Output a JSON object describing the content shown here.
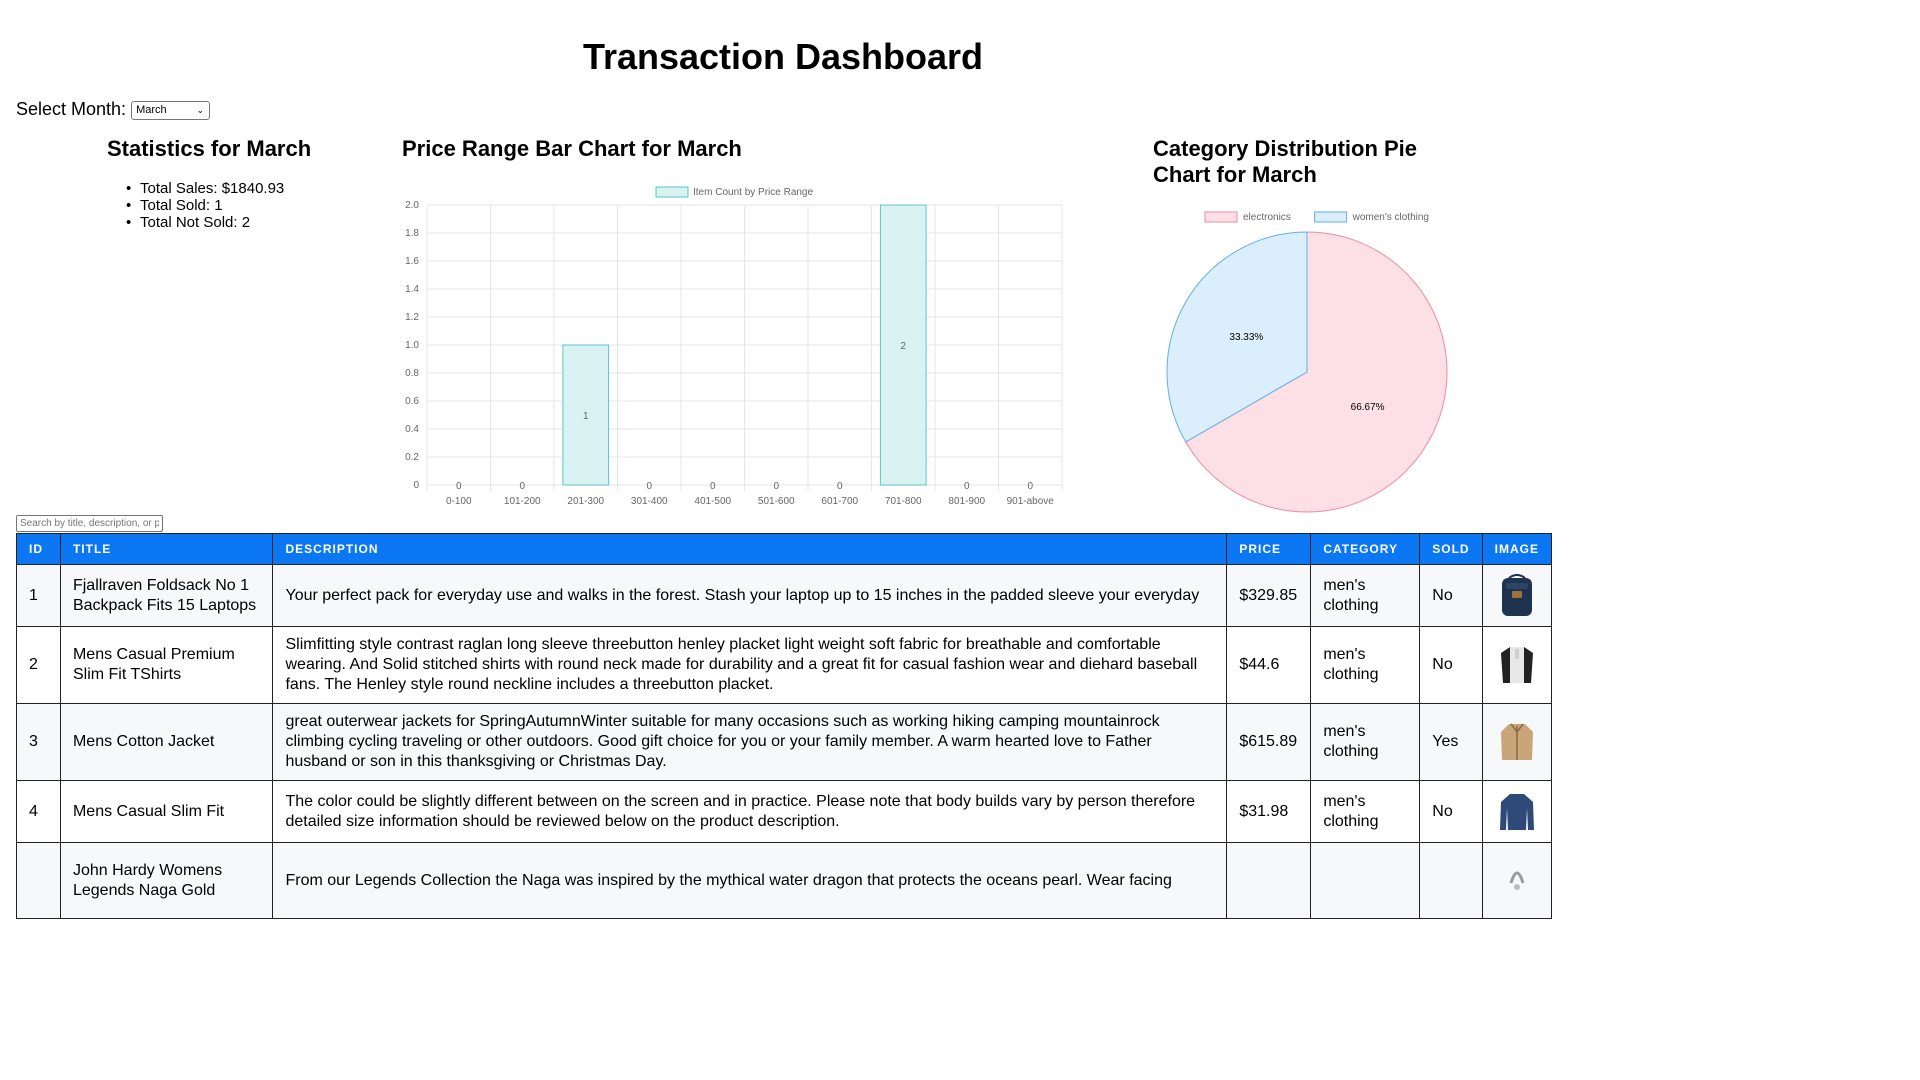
{
  "header": {
    "title": "Transaction Dashboard"
  },
  "month_selector": {
    "label": "Select Month:",
    "selected": "March"
  },
  "statistics": {
    "title": "Statistics for March",
    "items": [
      {
        "label": "Total Sales: $1840.93"
      },
      {
        "label": "Total Sold: 1"
      },
      {
        "label": "Total Not Sold: 2"
      }
    ]
  },
  "bar_section": {
    "title": "Price Range Bar Chart for March"
  },
  "pie_section": {
    "title_line1": "Category Distribution Pie",
    "title_line2": "Chart for March"
  },
  "chart_data": [
    {
      "type": "bar",
      "categories": [
        "0-100",
        "101-200",
        "201-300",
        "301-400",
        "401-500",
        "501-600",
        "601-700",
        "701-800",
        "801-900",
        "901-above"
      ],
      "series": [
        {
          "name": "Item Count by Price Range",
          "values": [
            0,
            0,
            1,
            0,
            0,
            0,
            0,
            2,
            0,
            0
          ]
        }
      ],
      "ylim": [
        0,
        2
      ],
      "yticks": [
        "0",
        "0.2",
        "0.4",
        "0.6",
        "0.8",
        "1.0",
        "1.2",
        "1.4",
        "1.6",
        "1.8",
        "2.0"
      ],
      "grid": true,
      "legend": "top",
      "colors": {
        "fill": "#d9f2f2",
        "stroke": "#5fc4c4"
      }
    },
    {
      "type": "pie",
      "labels": [
        "electronics",
        "women's clothing"
      ],
      "values": [
        66.67,
        33.33
      ],
      "value_labels": [
        "66.67%",
        "33.33%"
      ],
      "legend": "top",
      "colors": [
        {
          "fill": "#fde0e6",
          "stroke": "#f08aa0"
        },
        {
          "fill": "#dbeefb",
          "stroke": "#64aee6"
        }
      ]
    }
  ],
  "search": {
    "placeholder": "Search by title, description, or price"
  },
  "table": {
    "columns": [
      "ID",
      "TITLE",
      "DESCRIPTION",
      "PRICE",
      "CATEGORY",
      "SOLD",
      "IMAGE"
    ],
    "rows": [
      {
        "id": "1",
        "title": "Fjallraven Foldsack No 1 Backpack Fits 15 Laptops",
        "description": "Your perfect pack for everyday use and walks in the forest. Stash your laptop up to 15 inches in the padded sleeve your everyday",
        "price": "$329.85",
        "category": "men's clothing",
        "sold": "No",
        "image": "backpack-image"
      },
      {
        "id": "2",
        "title": "Mens Casual Premium Slim Fit TShirts",
        "description": "Slimfitting style contrast raglan long sleeve threebutton henley placket light weight soft fabric for breathable and comfortable wearing. And Solid stitched shirts with round neck made for durability and a great fit for casual fashion wear and diehard baseball fans. The Henley style round neckline includes a threebutton placket.",
        "price": "$44.6",
        "category": "men's clothing",
        "sold": "No",
        "image": "tshirt-image"
      },
      {
        "id": "3",
        "title": "Mens Cotton Jacket",
        "description": "great outerwear jackets for SpringAutumnWinter suitable for many occasions such as working hiking camping mountainrock climbing cycling traveling or other outdoors. Good gift choice for you or your family member. A warm hearted love to Father husband or son in this thanksgiving or Christmas Day.",
        "price": "$615.89",
        "category": "men's clothing",
        "sold": "Yes",
        "image": "jacket-image"
      },
      {
        "id": "4",
        "title": "Mens Casual Slim Fit",
        "description": "The color could be slightly different between on the screen and in practice. Please note that body builds vary by person therefore detailed size information should be reviewed below on the product description.",
        "price": "$31.98",
        "category": "men's clothing",
        "sold": "No",
        "image": "longsleeve-image"
      },
      {
        "id": "",
        "title": "John Hardy Womens Legends Naga Gold",
        "description": "From our Legends Collection the Naga was inspired by the mythical water dragon that protects the oceans pearl. Wear facing",
        "price": "",
        "category": "",
        "sold": "",
        "image": "bracelet-image"
      }
    ]
  }
}
